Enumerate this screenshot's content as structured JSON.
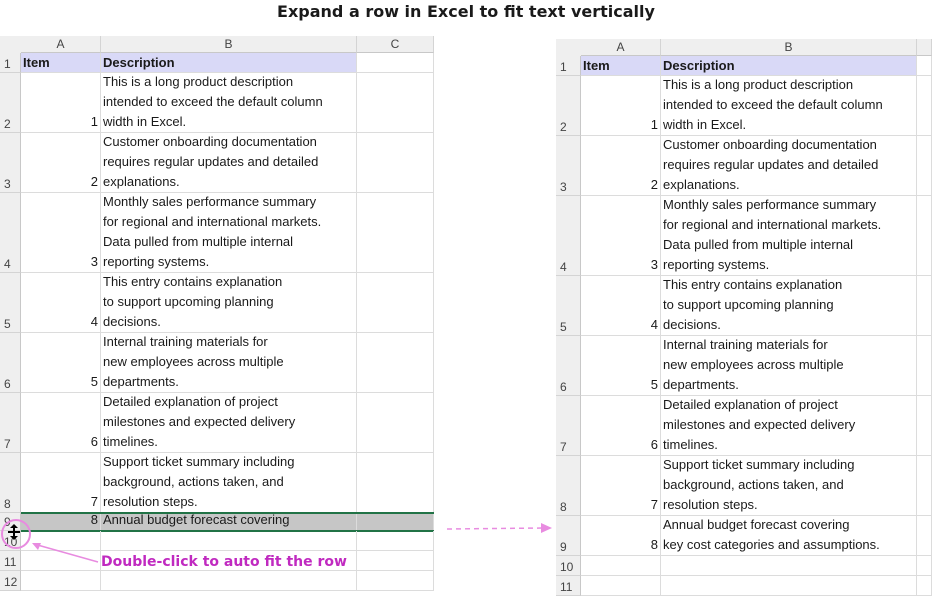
{
  "title": "Expand a row in Excel to fit text vertically",
  "annotation": "Double-click to auto fit the row",
  "left": {
    "columns": [
      "A",
      "B",
      "C"
    ],
    "header": {
      "row": "1",
      "item": "Item",
      "desc": "Description"
    },
    "rows": [
      {
        "row": "2",
        "item": "1",
        "desc": "This is a long product description\nintended to exceed the default column\nwidth in Excel."
      },
      {
        "row": "3",
        "item": "2",
        "desc": "Customer onboarding documentation\nrequires regular updates and detailed\nexplanations."
      },
      {
        "row": "4",
        "item": "3",
        "desc": "Monthly sales performance summary\nfor regional and international markets.\nData pulled from multiple internal\nreporting systems."
      },
      {
        "row": "5",
        "item": "4",
        "desc": "This entry contains explanation\nto support upcoming planning\ndecisions."
      },
      {
        "row": "6",
        "item": "5",
        "desc": "Internal training materials for\nnew employees across multiple\ndepartments."
      },
      {
        "row": "7",
        "item": "6",
        "desc": "Detailed explanation of project\nmilestones and expected delivery\ntimelines."
      },
      {
        "row": "8",
        "item": "7",
        "desc": "Support ticket summary including\nbackground, actions taken, and\nresolution steps."
      },
      {
        "row": "9",
        "item": "8",
        "desc": "Annual budget forecast covering"
      }
    ],
    "extra_rows": [
      "10",
      "11",
      "12"
    ]
  },
  "right": {
    "columns": [
      "A",
      "B"
    ],
    "header": {
      "row": "1",
      "item": "Item",
      "desc": "Description"
    },
    "rows": [
      {
        "row": "2",
        "item": "1",
        "desc": "This is a long product description\nintended to exceed the default column\nwidth in Excel."
      },
      {
        "row": "3",
        "item": "2",
        "desc": "Customer onboarding documentation\nrequires regular updates and detailed\nexplanations."
      },
      {
        "row": "4",
        "item": "3",
        "desc": "Monthly sales performance summary\nfor regional and international markets.\nData pulled from multiple internal\nreporting systems."
      },
      {
        "row": "5",
        "item": "4",
        "desc": "This entry contains explanation\nto support upcoming planning\ndecisions."
      },
      {
        "row": "6",
        "item": "5",
        "desc": "Internal training materials for\nnew employees across multiple\ndepartments."
      },
      {
        "row": "7",
        "item": "6",
        "desc": "Detailed explanation of project\nmilestones and expected delivery\ntimelines."
      },
      {
        "row": "8",
        "item": "7",
        "desc": "Support ticket summary including\nbackground, actions taken, and\nresolution steps."
      },
      {
        "row": "9",
        "item": "8",
        "desc": "Annual budget forecast covering\nkey cost categories and assumptions."
      }
    ],
    "extra_rows": [
      "10",
      "11"
    ]
  },
  "colors": {
    "header_fill": "#d9d9f7",
    "selection": "#c6c6c6",
    "annotation": "#c02ac0",
    "arrow": "#e88be0",
    "excel_green": "#217346"
  }
}
